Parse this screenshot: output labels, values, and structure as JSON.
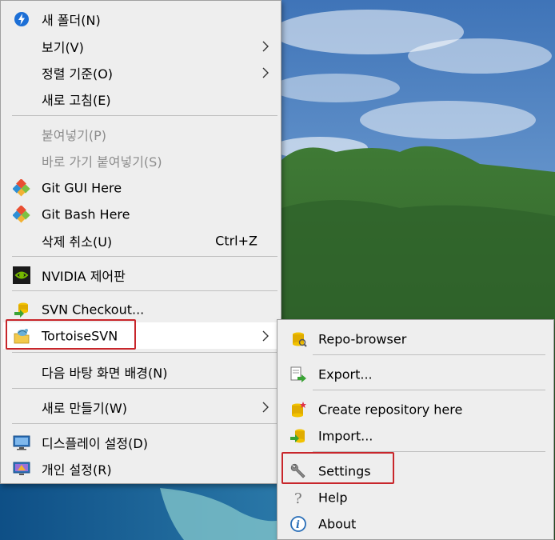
{
  "context_menu": {
    "items": [
      {
        "label": "새 폴더(N)",
        "icon": "new-folder-icon"
      },
      {
        "label": "보기(V)",
        "submenu": true
      },
      {
        "label": "정렬 기준(O)",
        "submenu": true
      },
      {
        "label": "새로 고침(E)"
      },
      {
        "label": "붙여넣기(P)",
        "disabled": true
      },
      {
        "label": "바로 가기 붙여넣기(S)",
        "disabled": true
      },
      {
        "label": "Git GUI Here",
        "icon": "git-icon"
      },
      {
        "label": "Git Bash Here",
        "icon": "git-icon"
      },
      {
        "label": "삭제 취소(U)",
        "shortcut": "Ctrl+Z"
      },
      {
        "label": "NVIDIA 제어판",
        "icon": "nvidia-icon"
      },
      {
        "label": "SVN Checkout...",
        "icon": "svn-checkout-icon"
      },
      {
        "label": "TortoiseSVN",
        "icon": "tortoisesvn-icon",
        "submenu": true,
        "highlighted": true
      },
      {
        "label": "다음 바탕 화면 배경(N)"
      },
      {
        "label": "새로 만들기(W)",
        "submenu": true
      },
      {
        "label": "디스플레이 설정(D)",
        "icon": "display-icon"
      },
      {
        "label": "개인 설정(R)",
        "icon": "personalize-icon"
      }
    ]
  },
  "tortoise_submenu": {
    "items": [
      {
        "label": "Repo-browser",
        "icon": "repo-browser-icon"
      },
      {
        "label": "Export...",
        "icon": "export-icon"
      },
      {
        "label": "Create repository here",
        "icon": "create-repo-icon"
      },
      {
        "label": "Import...",
        "icon": "import-icon"
      },
      {
        "label": "Settings",
        "icon": "wrench-icon",
        "highlighted": true
      },
      {
        "label": "Help",
        "icon": "help-icon"
      },
      {
        "label": "About",
        "icon": "about-icon"
      }
    ]
  },
  "colors": {
    "menu_bg": "#eeeeee",
    "highlight_box": "#c8262b",
    "disabled_text": "#8c8c8c"
  }
}
